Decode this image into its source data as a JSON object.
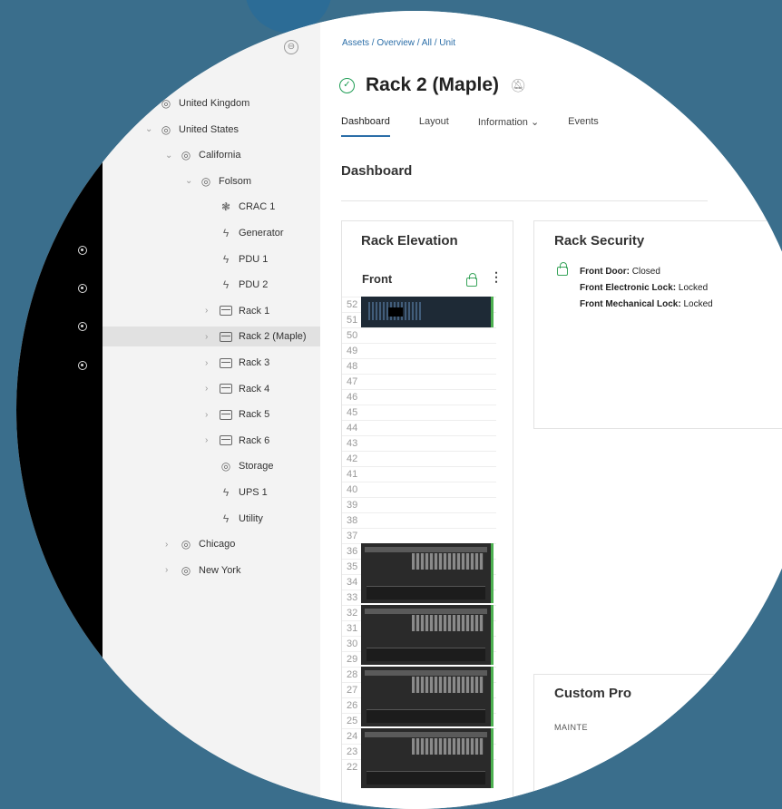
{
  "colors": {
    "background": "#3a6e8c",
    "accent": "#2b6ea8",
    "ok": "#1f9d55",
    "secure": "#3aa55c",
    "rail": "#000000"
  },
  "breadcrumb": "Assets / Overview / All / Unit",
  "page": {
    "title": "Rack 2 (Maple)",
    "status_icon": "check-circle-icon",
    "bell_icon": "bell-off-icon"
  },
  "tabs": [
    "Dashboard",
    "Layout",
    "Information ⌄",
    "Events"
  ],
  "section_title": "Dashboard",
  "tree": [
    {
      "label": "United Kingdom",
      "icon": "location-icon",
      "chev": ""
    },
    {
      "label": "United States",
      "icon": "location-icon",
      "chev": "⌄"
    },
    {
      "label": "California",
      "icon": "location-icon",
      "chev": "⌄"
    },
    {
      "label": "Folsom",
      "icon": "location-icon",
      "chev": "⌄"
    },
    {
      "label": "CRAC 1",
      "icon": "fan-icon",
      "chev": ""
    },
    {
      "label": "Generator",
      "icon": "power-icon",
      "chev": ""
    },
    {
      "label": "PDU 1",
      "icon": "power-icon",
      "chev": ""
    },
    {
      "label": "PDU 2",
      "icon": "power-icon",
      "chev": ""
    },
    {
      "label": "Rack 1",
      "icon": "rack-icon",
      "chev": "›"
    },
    {
      "label": "Rack 2 (Maple)",
      "icon": "rack-icon",
      "chev": "›",
      "selected": true
    },
    {
      "label": "Rack 3",
      "icon": "rack-icon",
      "chev": "›"
    },
    {
      "label": "Rack 4",
      "icon": "rack-icon",
      "chev": "›"
    },
    {
      "label": "Rack 5",
      "icon": "rack-icon",
      "chev": "›"
    },
    {
      "label": "Rack 6",
      "icon": "rack-icon",
      "chev": "›"
    },
    {
      "label": "Storage",
      "icon": "location-icon",
      "chev": ""
    },
    {
      "label": "UPS 1",
      "icon": "power-icon",
      "chev": ""
    },
    {
      "label": "Utility",
      "icon": "power-icon",
      "chev": ""
    },
    {
      "label": "Chicago",
      "icon": "location-icon",
      "chev": "›"
    },
    {
      "label": "New York",
      "icon": "location-icon",
      "chev": "›"
    }
  ],
  "rack_elevation": {
    "title": "Rack Elevation",
    "front_label": "Front",
    "slots": [
      "52",
      "51",
      "50",
      "49",
      "48",
      "47",
      "46",
      "45",
      "44",
      "43",
      "42",
      "41",
      "40",
      "39",
      "38",
      "37",
      "36",
      "35",
      "34",
      "33",
      "32",
      "31",
      "30",
      "29",
      "28",
      "27",
      "26",
      "25",
      "24",
      "23",
      "22"
    ]
  },
  "rack_security": {
    "title": "Rack Security",
    "rows": [
      {
        "key": "Front Door:",
        "value": "Closed"
      },
      {
        "key": "Front Electronic Lock:",
        "value": "Locked"
      },
      {
        "key": "Front Mechanical Lock:",
        "value": "Locked"
      }
    ]
  },
  "custom_props": {
    "title": "Custom Pro",
    "label": "MAINTE"
  }
}
